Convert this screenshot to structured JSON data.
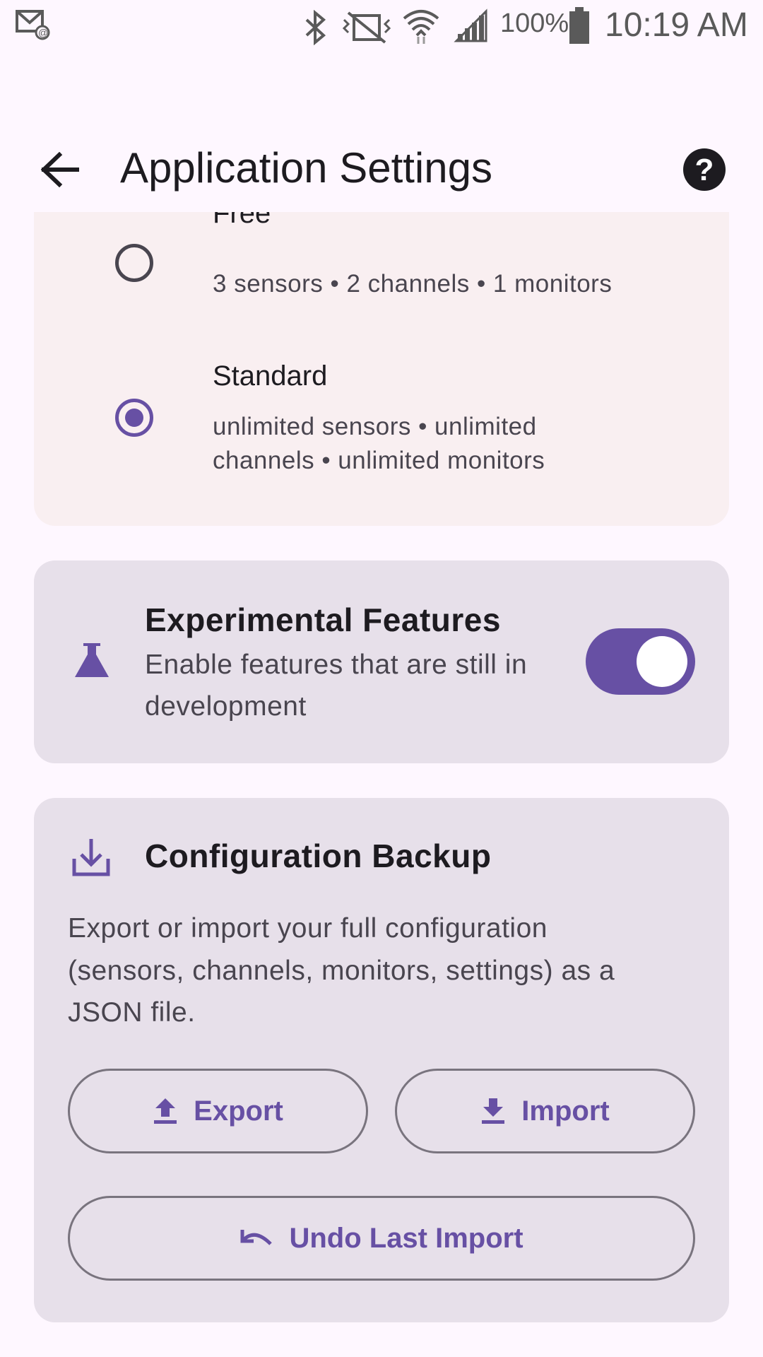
{
  "status_bar": {
    "battery": "100%",
    "time": "10:19 AM",
    "icons": [
      "email-notification-icon",
      "bluetooth-icon",
      "vibrate-icon",
      "wifi-icon",
      "signal-icon",
      "battery-icon"
    ]
  },
  "app_bar": {
    "title": "Application Settings",
    "back_icon": "arrow-back-icon",
    "help_icon": "help-icon"
  },
  "plans": [
    {
      "name": "Free",
      "description": "3 sensors • 2 channels • 1 monitors",
      "selected": false
    },
    {
      "name": "Standard",
      "description_line1": "unlimited sensors • unlimited",
      "description_line2": "channels • unlimited monitors",
      "selected": true
    }
  ],
  "experimental": {
    "icon": "flask-icon",
    "title": "Experimental Features",
    "description_line1": "Enable features that are still in",
    "description_line2": "development",
    "enabled": true
  },
  "backup": {
    "icon": "download-tray-icon",
    "title": "Configuration Backup",
    "description_line1": "Export or import your full configuration",
    "description_line2": "(sensors, channels, monitors, settings) as a",
    "description_line3": "JSON file.",
    "export_label": "Export",
    "import_label": "Import",
    "undo_label": "Undo Last Import"
  },
  "colors": {
    "accent": "#6750A4",
    "background": "#FEF7FF",
    "card": "#E7E0EA",
    "plan_card": "#F9EFF1"
  }
}
